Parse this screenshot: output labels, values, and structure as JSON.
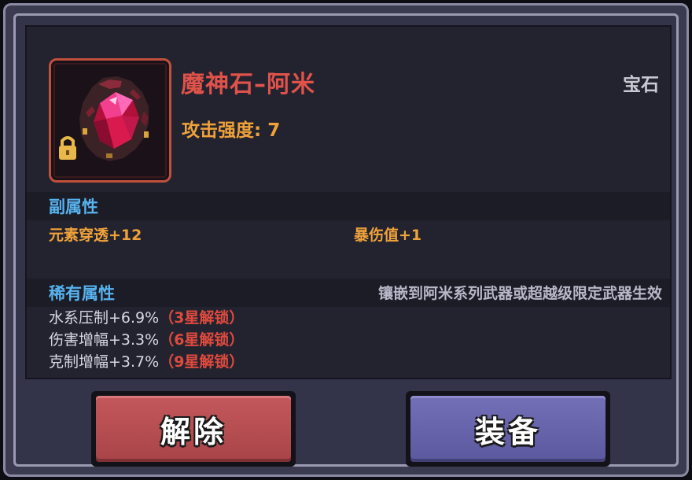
{
  "item": {
    "name": "魔神石–阿米",
    "category": "宝石",
    "attack": "攻击强度: 7",
    "icon": "gem-icon",
    "locked_icon": "lock-icon"
  },
  "sub_attributes": {
    "title": "副属性",
    "items": [
      "元素穿透+12",
      "暴伤值+1"
    ]
  },
  "rare_attributes": {
    "title": "稀有属性",
    "note": "镶嵌到阿米系列武器或超越级限定武器生效",
    "items": [
      {
        "text": "水系压制+6.9%",
        "lock": "（3星解锁）"
      },
      {
        "text": "伤害增幅+3.3%",
        "lock": "（6星解锁）"
      },
      {
        "text": "克制增幅+3.7%",
        "lock": "（9星解锁）"
      }
    ]
  },
  "buttons": {
    "remove": "解除",
    "equip": "装备"
  },
  "colors": {
    "title": "#e0524a",
    "attack": "#f0a23a",
    "section": "#57b2ee",
    "lock": "#e04a3e",
    "remove_button": "#b84c50",
    "equip_button": "#6864ac"
  }
}
